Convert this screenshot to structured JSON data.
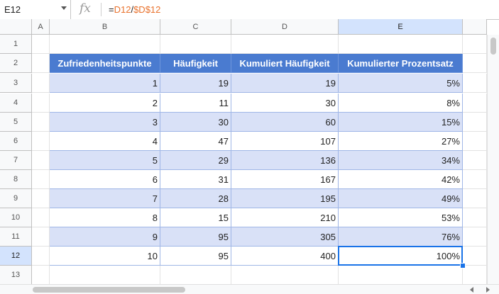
{
  "formula_bar": {
    "cell_ref": "E12",
    "fx_label": "fx",
    "formula_prefix": "=",
    "formula_ref1": "D12",
    "formula_sep": "/",
    "formula_ref2": "$D$12"
  },
  "columns": [
    {
      "id": "A",
      "label": "A"
    },
    {
      "id": "B",
      "label": "B"
    },
    {
      "id": "C",
      "label": "C"
    },
    {
      "id": "D",
      "label": "D"
    },
    {
      "id": "E",
      "label": "E"
    }
  ],
  "row_numbers": [
    "1",
    "2",
    "3",
    "4",
    "5",
    "6",
    "7",
    "8",
    "9",
    "10",
    "11",
    "12",
    "13"
  ],
  "selected": {
    "column": "E",
    "row": "12"
  },
  "table": {
    "headers": [
      "Zufriedenheitspunkte",
      "Häufigkeit",
      "Kumuliert Häufigkeit",
      "Kumulierter Prozentsatz"
    ],
    "rows": [
      [
        "1",
        "19",
        "19",
        "5%"
      ],
      [
        "2",
        "11",
        "30",
        "8%"
      ],
      [
        "3",
        "30",
        "60",
        "15%"
      ],
      [
        "4",
        "47",
        "107",
        "27%"
      ],
      [
        "5",
        "29",
        "136",
        "34%"
      ],
      [
        "6",
        "31",
        "167",
        "42%"
      ],
      [
        "7",
        "28",
        "195",
        "49%"
      ],
      [
        "8",
        "15",
        "210",
        "53%"
      ],
      [
        "9",
        "95",
        "305",
        "76%"
      ],
      [
        "10",
        "95",
        "400",
        "100%"
      ]
    ]
  }
}
